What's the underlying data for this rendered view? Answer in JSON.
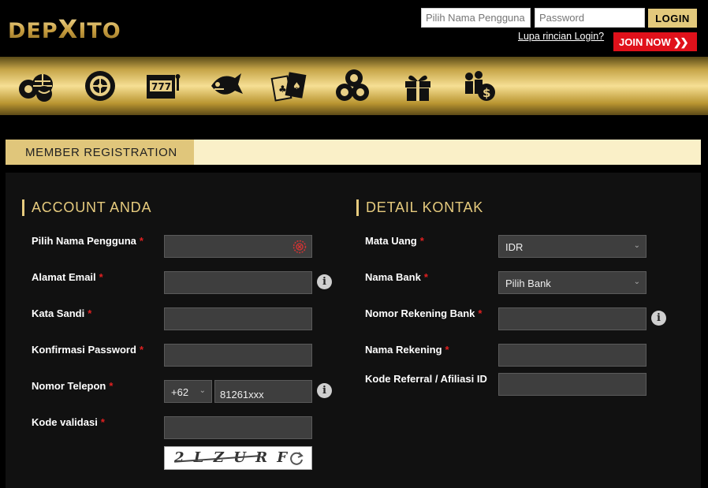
{
  "header": {
    "logo_text_left": "DEP",
    "logo_text_x": "X",
    "logo_text_right": "ITO",
    "username_placeholder": "Pilih Nama Pengguna",
    "password_placeholder": "Password",
    "login_label": "LOGIN",
    "forgot_label": "Lupa rincian Login?",
    "join_label": "JOIN NOW",
    "join_arrow": "❯❯"
  },
  "nav": {
    "items": [
      "sports-icon",
      "casino-roulette-icon",
      "slots-777-icon",
      "fish-shooting-icon",
      "cards-icon",
      "lottery-balls-icon",
      "promotion-gift-icon",
      "referral-money-icon"
    ]
  },
  "registration": {
    "tab_label": "MEMBER REGISTRATION"
  },
  "account": {
    "title": "ACCOUNT ANDA",
    "username_label": "Pilih Nama Pengguna",
    "email_label": "Alamat Email",
    "password_label": "Kata Sandi",
    "confirm_label": "Konfirmasi Password",
    "phone_label": "Nomor Telepon",
    "phone_code": "+62",
    "phone_value": "81261xxx",
    "captcha_label": "Kode validasi",
    "captcha_text": "2 L Z U R F",
    "required_mark": "*"
  },
  "contact": {
    "title": "DETAIL KONTAK",
    "currency_label": "Mata Uang",
    "currency_value": "IDR",
    "bank_label": "Nama Bank",
    "bank_value": "Pilih Bank",
    "account_number_label": "Nomor Rekening Bank",
    "account_name_label": "Nama Rekening",
    "referral_label": "Kode Referral / Afiliasi ID"
  },
  "colors": {
    "gold": "#e3c97c",
    "join_red": "#e0111b",
    "required_red": "#e02020",
    "field_bg": "#3e3e3e"
  }
}
